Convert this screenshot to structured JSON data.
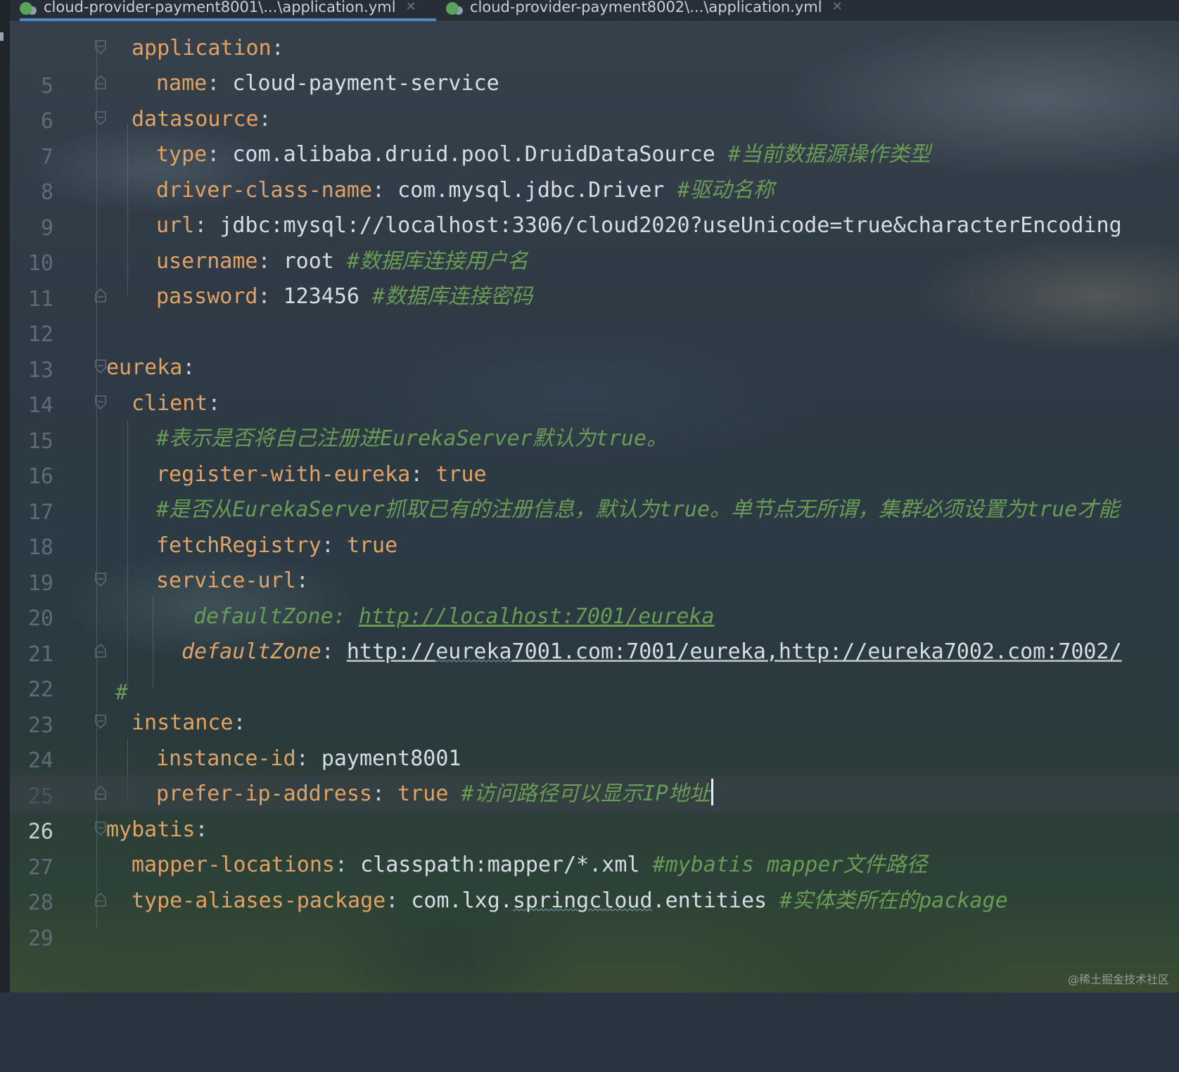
{
  "tabs": [
    {
      "label": "cloud-provider-payment8001\\...\\application.yml",
      "active": true
    },
    {
      "label": "cloud-provider-payment8002\\...\\application.yml",
      "active": false
    }
  ],
  "editor": {
    "current_line": 26,
    "lines": [
      {
        "n": "5"
      },
      {
        "n": "6"
      },
      {
        "n": "7"
      },
      {
        "n": "8"
      },
      {
        "n": "9"
      },
      {
        "n": "10"
      },
      {
        "n": "11"
      },
      {
        "n": "12"
      },
      {
        "n": "13"
      },
      {
        "n": "14"
      },
      {
        "n": "15"
      },
      {
        "n": "16"
      },
      {
        "n": "17"
      },
      {
        "n": "18"
      },
      {
        "n": "19"
      },
      {
        "n": "20"
      },
      {
        "n": "21"
      },
      {
        "n": "22"
      },
      {
        "n": "23"
      },
      {
        "n": "24"
      },
      {
        "n": "25"
      },
      {
        "n": "26"
      },
      {
        "n": "27"
      },
      {
        "n": "28"
      },
      {
        "n": "29"
      }
    ],
    "code": {
      "l5_key": "application",
      "l6_key": "name",
      "l6_val": "cloud-payment-service",
      "l7_key": "datasource",
      "l8_key": "type",
      "l8_val": "com.alibaba.druid.pool.DruidDataSource",
      "l8_comment": "#当前数据源操作类型",
      "l9_key": "driver-class-name",
      "l9_val": "com.mysql.jdbc.Driver",
      "l9_comment": "#驱动名称",
      "l10_key": "url",
      "l10_val": "jdbc:mysql://localhost:3306/cloud2020?useUnicode=true&characterEncoding",
      "l11_key": "username",
      "l11_val": "root",
      "l11_comment": "#数据库连接用户名",
      "l12_key": "password",
      "l12_val": "123456",
      "l12_comment": "#数据库连接密码",
      "l14_key": "eureka",
      "l15_key": "client",
      "l16_comment": "#表示是否将自己注册进EurekaServer默认为true。",
      "l17_key": "register-with-eureka",
      "l17_val": "true",
      "l18_comment": "#是否从EurekaServer抓取已有的注册信息，默认为true。单节点无所谓，集群必须设置为true才能",
      "l19_key": "fetchRegistry",
      "l19_val": "true",
      "l20_key": "service-url",
      "l21_hash": "#",
      "l21_key": "defaultZone:",
      "l21_val": "http://localhost:7001/eureka",
      "l22_key": "defaultZone",
      "l22_val_a": "http://",
      "l22_val_b": "eureka",
      "l22_val_c": "7001.com:7001/eureka,http://eureka7002.com:7002/",
      "l24_key": "instance",
      "l25_key": "instance-id",
      "l25_val": "payment8001",
      "l26_key": "prefer-ip-address",
      "l26_val": "true",
      "l26_comment": "#访问路径可以显示IP地址",
      "l27_key": "mybatis",
      "l28_key": "mapper-locations",
      "l28_val": "classpath:mapper/*.xml",
      "l28_comment": "#mybatis mapper文件路径",
      "l29_key": "type-aliases-package",
      "l29_val_a": "com.lxg.",
      "l29_val_b": "springcloud",
      "l29_val_c": ".entities",
      "l29_comment": "#实体类所在的package"
    }
  },
  "watermark": "@稀土掘金技术社区",
  "colors": {
    "key": "#e0a365",
    "value": "#d6dde4",
    "comment": "#6a9b55",
    "tab_accent": "#4a88c7"
  }
}
